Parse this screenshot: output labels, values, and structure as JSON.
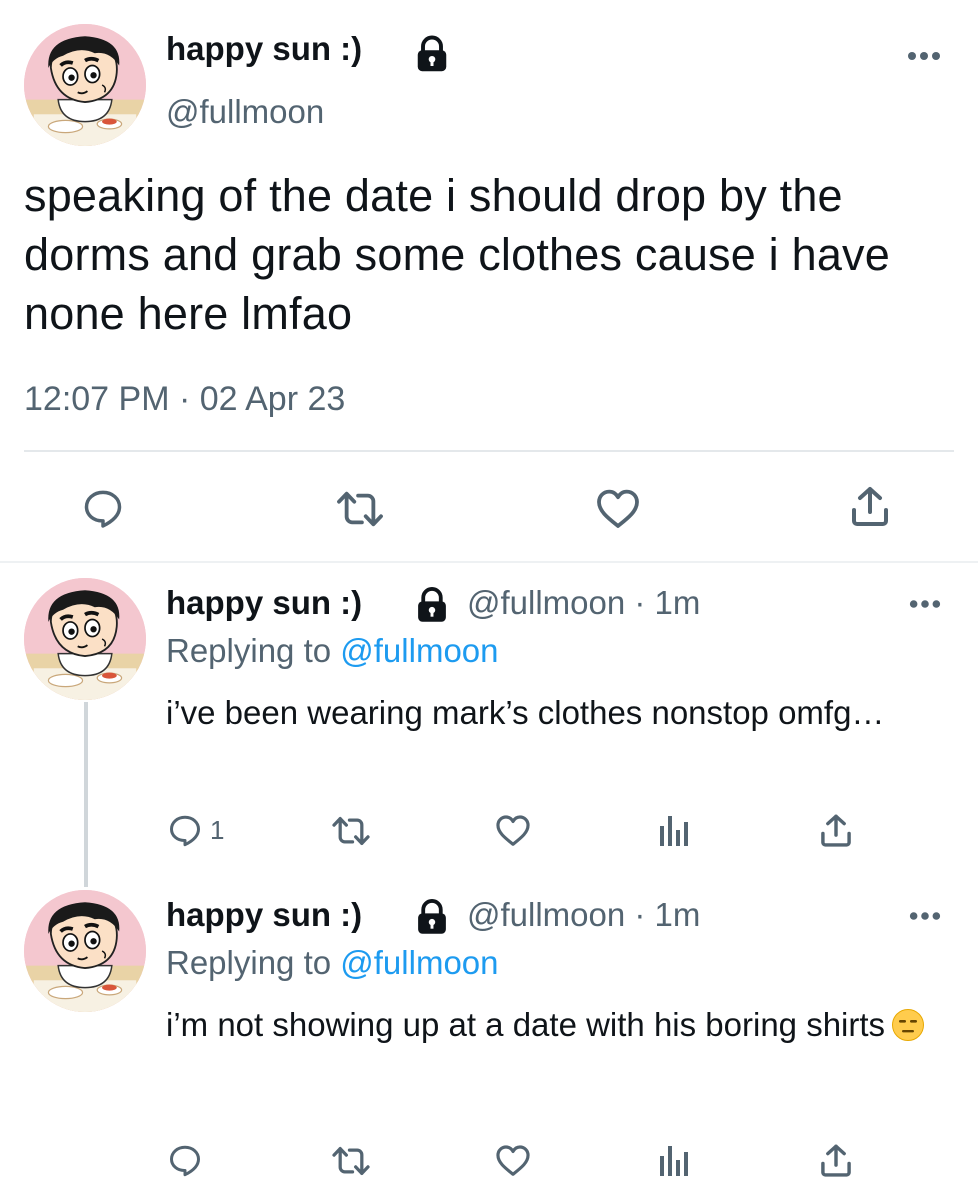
{
  "main_tweet": {
    "display_name": "happy sun :)",
    "handle": "@fullmoon",
    "text": "speaking of the date i should drop by the dorms and grab some clothes cause i have none here lmfao",
    "timestamp": "12:07 PM · 02 Apr 23",
    "icons": [
      "lock-icon",
      "more-icon",
      "reply-icon",
      "retweet-icon",
      "like-icon",
      "share-icon"
    ]
  },
  "replies": [
    {
      "display_name": "happy sun :)",
      "meta": "@fullmoon · 1m",
      "replying_label": "Replying to ",
      "replying_handle": "@fullmoon",
      "text": "i’ve been wearing mark’s clothes nonstop omfg…",
      "reply_count": "1"
    },
    {
      "display_name": "happy sun :)",
      "meta": "@fullmoon · 1m",
      "replying_label": "Replying to ",
      "replying_handle": "@fullmoon",
      "text": "i’m not showing up at a date with his boring shirts",
      "emoji": "expressionless-face"
    }
  ],
  "colors": {
    "text": "#0f1419",
    "secondary": "#536471",
    "link": "#1d9bf0",
    "divider": "#e4e8eb"
  }
}
